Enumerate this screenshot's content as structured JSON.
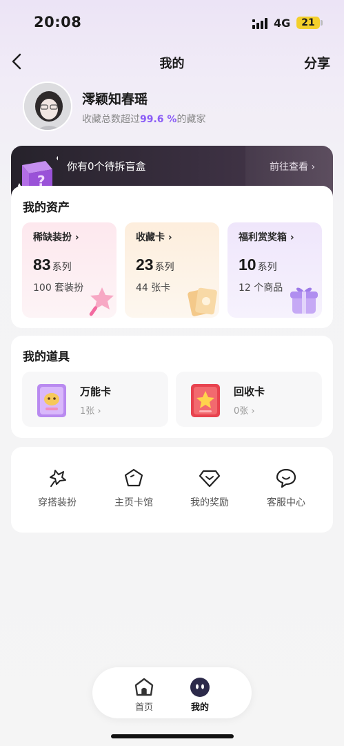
{
  "status_bar": {
    "time": "20:08",
    "network": "4G",
    "battery": "21"
  },
  "header": {
    "title": "我的",
    "share_label": "分享"
  },
  "profile": {
    "username": "澪颖知春瑶",
    "stat_prefix": "收藏总数超过",
    "stat_value": "99.6 %",
    "stat_suffix": "的藏家"
  },
  "blind_box": {
    "text": "你有0个待拆盲盒",
    "link": "前往查看 ›"
  },
  "assets": {
    "title": "我的资产",
    "tiles": [
      {
        "label": "稀缺装扮 ›",
        "number": "83",
        "unit": "系列",
        "sub": "100 套装扮",
        "color": "#fbeef1"
      },
      {
        "label": "收藏卡 ›",
        "number": "23",
        "unit": "系列",
        "sub": "44 张卡",
        "color": "#fdf2e4"
      },
      {
        "label": "福利赏奖箱 ›",
        "number": "10",
        "unit": "系列",
        "sub": "12 个商品",
        "color": "#f1ecfb"
      }
    ]
  },
  "props": {
    "title": "我的道具",
    "items": [
      {
        "name": "万能卡",
        "count": "1张 ›"
      },
      {
        "name": "回收卡",
        "count": "0张 ›"
      }
    ]
  },
  "tools": [
    {
      "label": "穿搭装扮",
      "icon": "outfit-icon"
    },
    {
      "label": "主页卡馆",
      "icon": "pentagon-icon"
    },
    {
      "label": "我的奖励",
      "icon": "gem-icon"
    },
    {
      "label": "客服中心",
      "icon": "chat-smile-icon"
    }
  ],
  "nav": [
    {
      "label": "首页",
      "icon": "home-icon"
    },
    {
      "label": "我的",
      "icon": "mascot-icon"
    }
  ]
}
